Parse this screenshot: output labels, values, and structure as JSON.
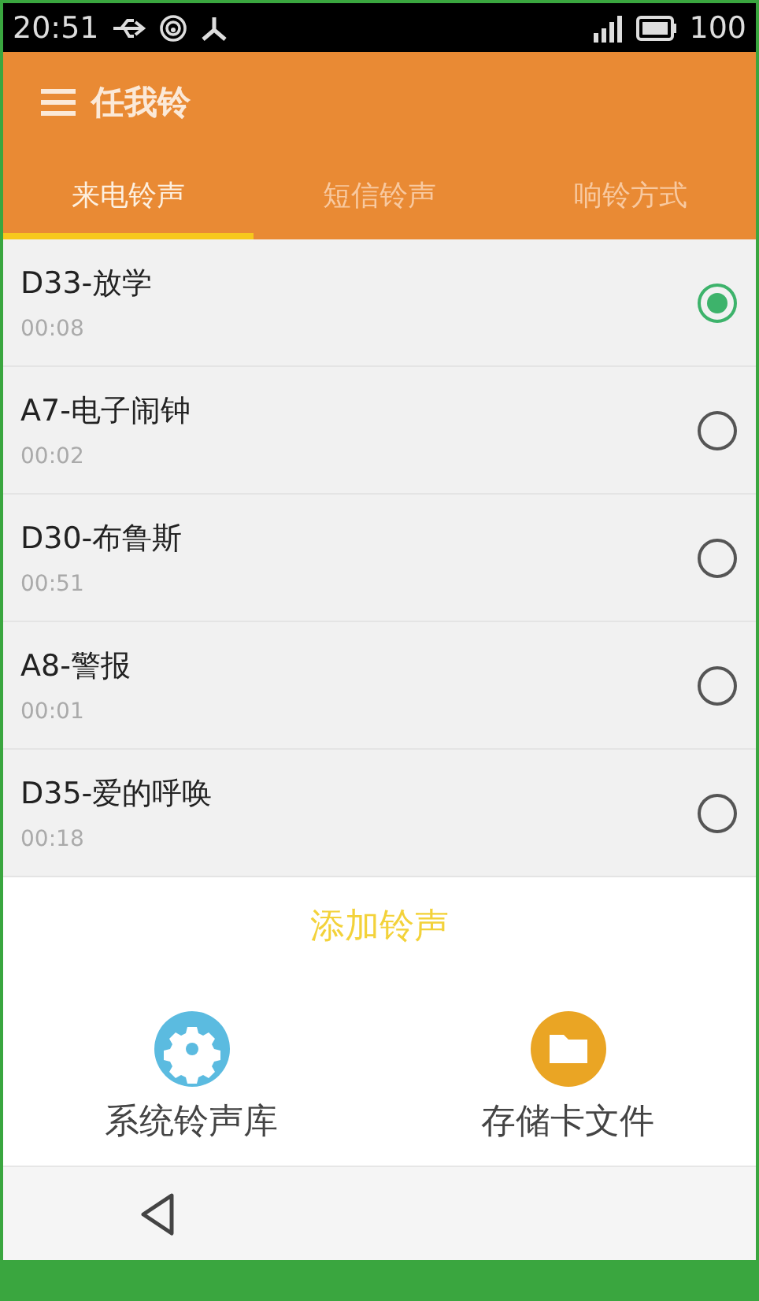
{
  "status_bar": {
    "time": "20:51",
    "battery": "100"
  },
  "app_bar": {
    "title": "任我铃"
  },
  "tabs": [
    {
      "label": "来电铃声",
      "selected": true
    },
    {
      "label": "短信铃声",
      "selected": false
    },
    {
      "label": "响铃方式",
      "selected": false
    }
  ],
  "ringtones": [
    {
      "name": "D33-放学",
      "duration": "00:08",
      "selected": true
    },
    {
      "name": "A7-电子闹钟",
      "duration": "00:02",
      "selected": false
    },
    {
      "name": "D30-布鲁斯",
      "duration": "00:51",
      "selected": false
    },
    {
      "name": "A8-警报",
      "duration": "00:01",
      "selected": false
    },
    {
      "name": "D35-爱的呼唤",
      "duration": "00:18",
      "selected": false
    }
  ],
  "add_button": {
    "label": "添加铃声"
  },
  "sources": [
    {
      "kind": "system",
      "label": "系统铃声库"
    },
    {
      "kind": "storage",
      "label": "存储卡文件"
    }
  ]
}
